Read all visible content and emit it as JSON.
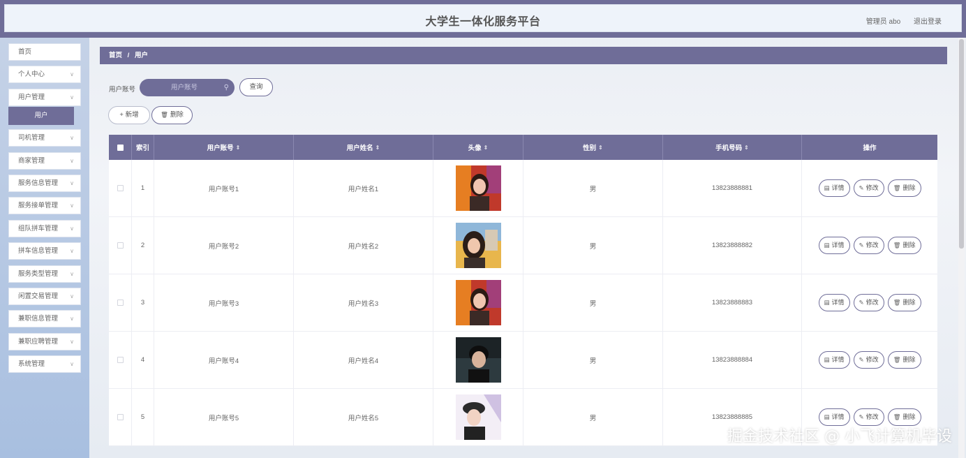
{
  "header": {
    "title": "大学生一体化服务平台",
    "user": "管理员 abo",
    "logout": "退出登录"
  },
  "sidebar": {
    "items": [
      {
        "label": "首页",
        "chevron": false
      },
      {
        "label": "个人中心",
        "chevron": true
      },
      {
        "label": "用户管理",
        "chevron": true
      },
      {
        "label": "司机管理",
        "chevron": true
      },
      {
        "label": "商家管理",
        "chevron": true
      },
      {
        "label": "服务信息管理",
        "chevron": true
      },
      {
        "label": "服务接单管理",
        "chevron": true
      },
      {
        "label": "组队拼车管理",
        "chevron": true
      },
      {
        "label": "拼车信息管理",
        "chevron": true
      },
      {
        "label": "服务类型管理",
        "chevron": true
      },
      {
        "label": "闲置交易管理",
        "chevron": true
      },
      {
        "label": "兼职信息管理",
        "chevron": true
      },
      {
        "label": "兼职应聘管理",
        "chevron": true
      },
      {
        "label": "系统管理",
        "chevron": true
      }
    ],
    "active_sub": "用户"
  },
  "breadcrumb": {
    "home": "首页",
    "sep": "/",
    "current": "用户"
  },
  "search": {
    "label": "用户账号",
    "placeholder": "用户账号",
    "query_button": "查询"
  },
  "actions": {
    "add": "+ 新增",
    "delete": "删除"
  },
  "table": {
    "columns": {
      "index": "索引",
      "account": "用户账号",
      "name": "用户姓名",
      "avatar": "头像",
      "gender": "性别",
      "phone": "手机号码",
      "ops": "操作"
    },
    "rows": [
      {
        "index": "1",
        "account": "用户账号1",
        "name": "用户姓名1",
        "gender": "男",
        "phone": "13823888881"
      },
      {
        "index": "2",
        "account": "用户账号2",
        "name": "用户姓名2",
        "gender": "男",
        "phone": "13823888882"
      },
      {
        "index": "3",
        "account": "用户账号3",
        "name": "用户姓名3",
        "gender": "男",
        "phone": "13823888883"
      },
      {
        "index": "4",
        "account": "用户账号4",
        "name": "用户姓名4",
        "gender": "男",
        "phone": "13823888884"
      },
      {
        "index": "5",
        "account": "用户账号5",
        "name": "用户姓名5",
        "gender": "男",
        "phone": "13823888885"
      }
    ],
    "row_buttons": {
      "detail": "详情",
      "edit": "修改",
      "delete": "删除"
    }
  },
  "watermark": "掘金技术社区 @ 小飞计算机毕设",
  "colors": {
    "primary": "#6f6d98",
    "sidebar": "#a8bfe0",
    "header_bg": "#eef3fa"
  }
}
